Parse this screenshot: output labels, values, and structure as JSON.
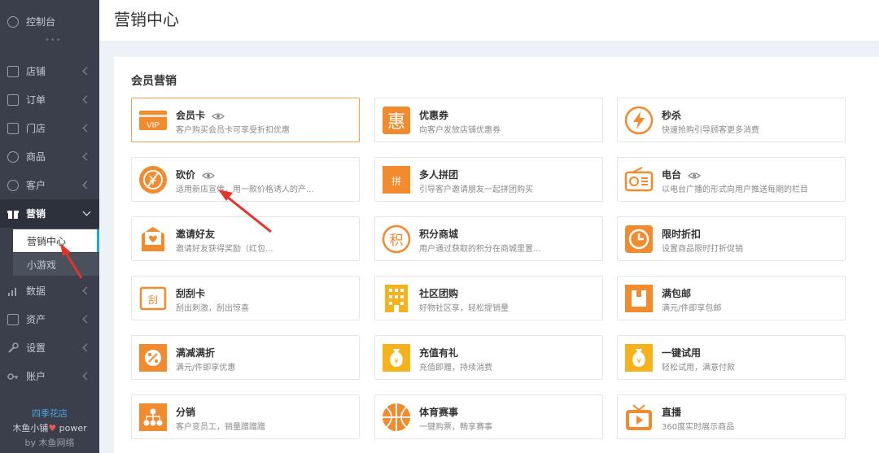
{
  "sidebar": {
    "dashboard": "控制台",
    "dots": "•••",
    "items": [
      {
        "label": "店铺"
      },
      {
        "label": "订单"
      },
      {
        "label": "门店"
      },
      {
        "label": "商品"
      },
      {
        "label": "客户"
      },
      {
        "label": "营销"
      },
      {
        "label": "数据"
      },
      {
        "label": "资产"
      },
      {
        "label": "设置"
      },
      {
        "label": "账户"
      }
    ],
    "submenu": [
      {
        "label": "营销中心"
      },
      {
        "label": "小游戏"
      }
    ],
    "brand": {
      "shop": "四季花店",
      "power_prefix": "木鱼小铺",
      "power_suffix": " power",
      "by": "by 木鱼网络"
    }
  },
  "header": {
    "title": "营销中心"
  },
  "section": {
    "title": "会员营销"
  },
  "cards": [
    {
      "title": "会员卡",
      "desc": "客户购买会员卡可享受折扣优惠"
    },
    {
      "title": "优惠券",
      "desc": "向客户发放店铺优惠券"
    },
    {
      "title": "秒杀",
      "desc": "快速抢购引导顾客更多消费"
    },
    {
      "title": "砍价",
      "desc": "适用新店宣传，用一款价格诱人的产..."
    },
    {
      "title": "多人拼团",
      "desc": "引导客户邀请朋友一起拼团购买"
    },
    {
      "title": "电台",
      "desc": "以电台广播的形式向用户推送每期的栏目"
    },
    {
      "title": "邀请好友",
      "desc": "邀请好友获得奖励（红包..."
    },
    {
      "title": "积分商城",
      "desc": "用户通过获取的积分在商城里置..."
    },
    {
      "title": "限时折扣",
      "desc": "设置商品限时打折促销"
    },
    {
      "title": "刮刮卡",
      "desc": "刮出刺激，刮出惊喜"
    },
    {
      "title": "社区团购",
      "desc": "好物社区享，轻松提销量"
    },
    {
      "title": "满包邮",
      "desc": "满元/件即享包邮"
    },
    {
      "title": "满减满折",
      "desc": "满元/件即享优惠"
    },
    {
      "title": "充值有礼",
      "desc": "充值即赠，持续消费"
    },
    {
      "title": "一键试用",
      "desc": "轻松试用，满意付款"
    },
    {
      "title": "分销",
      "desc": "客户变员工，销量蹭蹭蹭"
    },
    {
      "title": "体育赛事",
      "desc": "一键购票，畅享赛事"
    },
    {
      "title": "直播",
      "desc": "360度实时展示商品"
    }
  ],
  "icon_labels": {
    "vip": "VIP",
    "hui": "惠",
    "pin": "拼",
    "ji": "积",
    "gua": "刮"
  },
  "colors": {
    "accent": "#f39c4b",
    "orange": "#f28a2e",
    "yellow": "#f5b21b",
    "sidebar_bg": "#3a3f4b",
    "highlight": "#19a7e0",
    "arrow": "#e5332a"
  }
}
